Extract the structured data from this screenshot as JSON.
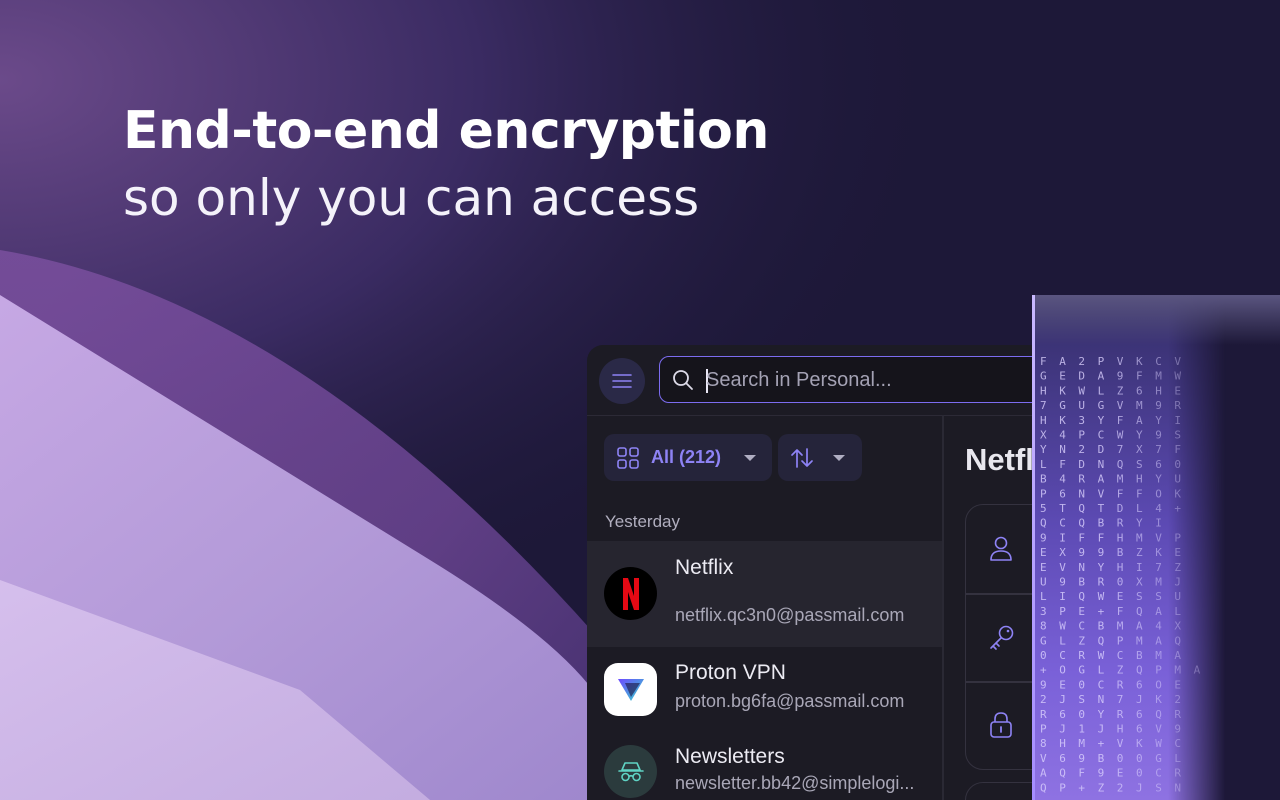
{
  "headline": {
    "line1": "End-to-end encryption",
    "line2": "so only you can access"
  },
  "app": {
    "search": {
      "placeholder": "Search in Personal..."
    },
    "filter": {
      "label": "All (212)"
    },
    "section_label": "Yesterday",
    "items": [
      {
        "title": "Netflix",
        "subtitle": "netflix.qc3n0@passmail.com",
        "icon": "netflix-logo",
        "active": true
      },
      {
        "title": "Proton VPN",
        "subtitle": "proton.bg6fa@passmail.com",
        "icon": "proton-vpn-logo"
      },
      {
        "title": "Newsletters",
        "subtitle": "newsletter.bb42@simplelogi...",
        "icon": "incognito-icon"
      }
    ],
    "detail": {
      "title": "Netfli"
    },
    "detail_icons": [
      "user-icon",
      "key-icon",
      "lock-icon"
    ]
  },
  "encryption_grid": {
    "rows": [
      "FA2PVKCV",
      "GEDA9FMW",
      "HKWLZ6HE",
      "7GUGVM9R",
      "HK3YFAYI",
      "X4PCWY9S",
      "YN2D7X7F",
      "LFDNQS60",
      "B4RAMHYU",
      "P6NVFFOK",
      "5TQTDL4+",
      "QCQBRYI",
      "9IFFHMVP",
      "EX99BZKE",
      "EVNYHI7Z",
      "U9BR0XMJ",
      "LIQWESSU",
      "3PE+FQAL",
      "8WCBMA4X",
      "GLZQPMAQ",
      "0CRWCBMA",
      "+OGLZQPMA",
      "9E0CR6OE",
      "2JSN7JK2",
      "R60YR6QR",
      "PJ1JH6V9",
      "8HM+VKWC",
      "V69B00GL",
      "AQF9E0CR",
      "QP+Z2JSN"
    ]
  },
  "colors": {
    "accent": "#8e83f5",
    "background_dark": "#1d1838",
    "panel": "#1c1b24",
    "netflix_red": "#e50914"
  }
}
